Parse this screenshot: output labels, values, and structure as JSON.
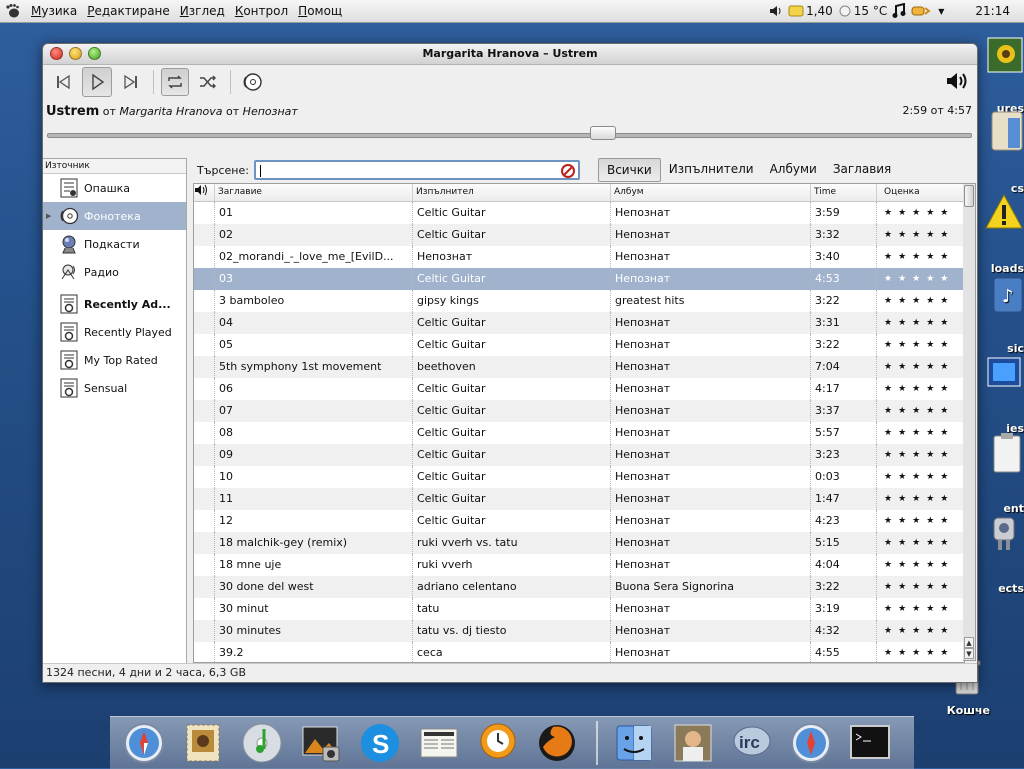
{
  "top_panel": {
    "menus": [
      "Музика",
      "Редактиране",
      "Изглед",
      "Контрол",
      "Помощ"
    ],
    "cpu": "1,40",
    "temperature": "15 °C",
    "clock": "21:14"
  },
  "window": {
    "title": "Margarita Hranova – Ustrem"
  },
  "now_playing": {
    "song": "Ustrem",
    "from1": "от",
    "artist": "Margarita Hranova",
    "from2": "от",
    "album": "Непознат",
    "time": "2:59 от 4:57",
    "progress": 0.6
  },
  "sidebar": {
    "header": "Източник",
    "items": [
      {
        "label": "Опашка",
        "icon": "queue-icon"
      },
      {
        "label": "Фонотека",
        "icon": "library-icon"
      },
      {
        "label": "Подкасти",
        "icon": "podcast-icon"
      },
      {
        "label": "Радио",
        "icon": "radio-icon"
      },
      {
        "label": "Recently Ad...",
        "icon": "smart-playlist-icon"
      },
      {
        "label": "Recently Played",
        "icon": "smart-playlist-icon"
      },
      {
        "label": "My Top Rated",
        "icon": "smart-playlist-icon"
      },
      {
        "label": "Sensual",
        "icon": "smart-playlist-icon"
      }
    ]
  },
  "search": {
    "label": "Търсене:",
    "value": "",
    "filters": [
      "Всички",
      "Изпълнители",
      "Албуми",
      "Заглавия"
    ],
    "active_filter": "Всички"
  },
  "table": {
    "columns": [
      "Заглавие",
      "Изпълнител",
      "Албум",
      "Time",
      "Оценка"
    ],
    "rating_stars": "★★★★★",
    "selected_index": 3,
    "rows": [
      [
        "01",
        "Celtic Guitar",
        "Непознат",
        "3:59"
      ],
      [
        "02",
        "Celtic Guitar",
        "Непознат",
        "3:32"
      ],
      [
        "02_morandi_-_love_me_[EvilD...",
        "Непознат",
        "Непознат",
        "3:40"
      ],
      [
        "03",
        "Celtic Guitar",
        "Непознат",
        "4:53"
      ],
      [
        "3 bamboleo",
        "gipsy kings",
        "greatest hits",
        "3:22"
      ],
      [
        "04",
        "Celtic Guitar",
        "Непознат",
        "3:31"
      ],
      [
        "05",
        "Celtic Guitar",
        "Непознат",
        "3:22"
      ],
      [
        "5th symphony 1st movement",
        "beethoven",
        "Непознат",
        "7:04"
      ],
      [
        "06",
        "Celtic Guitar",
        "Непознат",
        "4:17"
      ],
      [
        "07",
        "Celtic Guitar",
        "Непознат",
        "3:37"
      ],
      [
        "08",
        "Celtic Guitar",
        "Непознат",
        "5:57"
      ],
      [
        "09",
        "Celtic Guitar",
        "Непознат",
        "3:23"
      ],
      [
        "10",
        "Celtic Guitar",
        "Непознат",
        "0:03"
      ],
      [
        "11",
        "Celtic Guitar",
        "Непознат",
        "1:47"
      ],
      [
        "12",
        "Celtic Guitar",
        "Непознат",
        "4:23"
      ],
      [
        "18 malchik-gey (remix)",
        "ruki vverh vs. tatu",
        "Непознат",
        "5:15"
      ],
      [
        "18 mne uje",
        "ruki vverh",
        "Непознат",
        "4:04"
      ],
      [
        "30 done del west",
        "adriano celentano",
        "Buona Sera Signorina",
        "3:22"
      ],
      [
        "30 minut",
        "tatu",
        "Непознат",
        "3:19"
      ],
      [
        "30 minutes",
        "tatu vs. dj tiesto",
        "Непознат",
        "4:32"
      ],
      [
        "39.2",
        "ceca",
        "Непознат",
        "4:55"
      ]
    ]
  },
  "status": "1324 песни, 4 дни и 2 часа, 6,3 GB",
  "desktop": {
    "labels": [
      "ures",
      "cs",
      "loads",
      "sic",
      "ies",
      "ent",
      "ects"
    ],
    "trash_label": "Кошче"
  },
  "dock": {
    "items": [
      "safari-icon",
      "stamp-mail-icon",
      "itunes-icon",
      "photo-icon",
      "skype-icon",
      "news-icon",
      "clock-icon",
      "firefox-icon",
      "finder-icon",
      "user-photo-icon",
      "irc-icon",
      "safari-icon",
      "terminal-icon"
    ]
  },
  "colors": {
    "selection": "#a0b2cc",
    "desktop": "#24508a"
  }
}
